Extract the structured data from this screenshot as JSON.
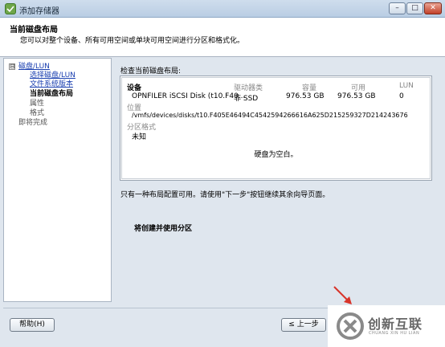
{
  "window": {
    "title": "添加存储器",
    "controls": {
      "minimize": "–",
      "maximize": "□",
      "close": "✕"
    }
  },
  "header": {
    "title": "当前磁盘布局",
    "description": "您可以对整个设备、所有可用空间或单块可用空间进行分区和格式化。"
  },
  "sidebar": {
    "toggle": "⊟",
    "group": "磁盘/LUN",
    "items": [
      {
        "label": "选择磁盘/LUN",
        "state": "link"
      },
      {
        "label": "文件系统版本",
        "state": "link"
      },
      {
        "label": "当前磁盘布局",
        "state": "current"
      },
      {
        "label": "属性",
        "state": "disabled"
      },
      {
        "label": "格式",
        "state": "disabled"
      }
    ],
    "finish": "即将完成"
  },
  "main": {
    "section_label": "检查当前磁盘布局:",
    "columns": {
      "device": "设备",
      "drive_type": "驱动器类",
      "capacity": "容量",
      "available": "可用",
      "lun": "LUN"
    },
    "disk": {
      "device": "OPNFILER iSCSI Disk (t10.F40...",
      "drive_type": "非 SSD",
      "capacity": "976.53 GB",
      "available": "976.53 GB",
      "lun": "0"
    },
    "location_label": "位置",
    "location": "/vmfs/devices/disks/t10.F405E46494C4542594266616A625D215259327D214243676",
    "partition_label": "分区格式",
    "partition": "未知",
    "empty_message": "硬盘为空白。",
    "note": "只有一种布局配置可用。请使用\"下一步\"按钮继续其余向导页面。",
    "action": "将创建并使用分区"
  },
  "footer": {
    "help": "帮助(H)",
    "back": "≤ 上一步"
  },
  "watermark": {
    "text": "创新互联",
    "sub": "CHUANG XIN HU LIAN"
  },
  "colors": {
    "link": "#1a3fb0",
    "arrow": "#d8342a",
    "titlebar": "#c3d4e8"
  }
}
